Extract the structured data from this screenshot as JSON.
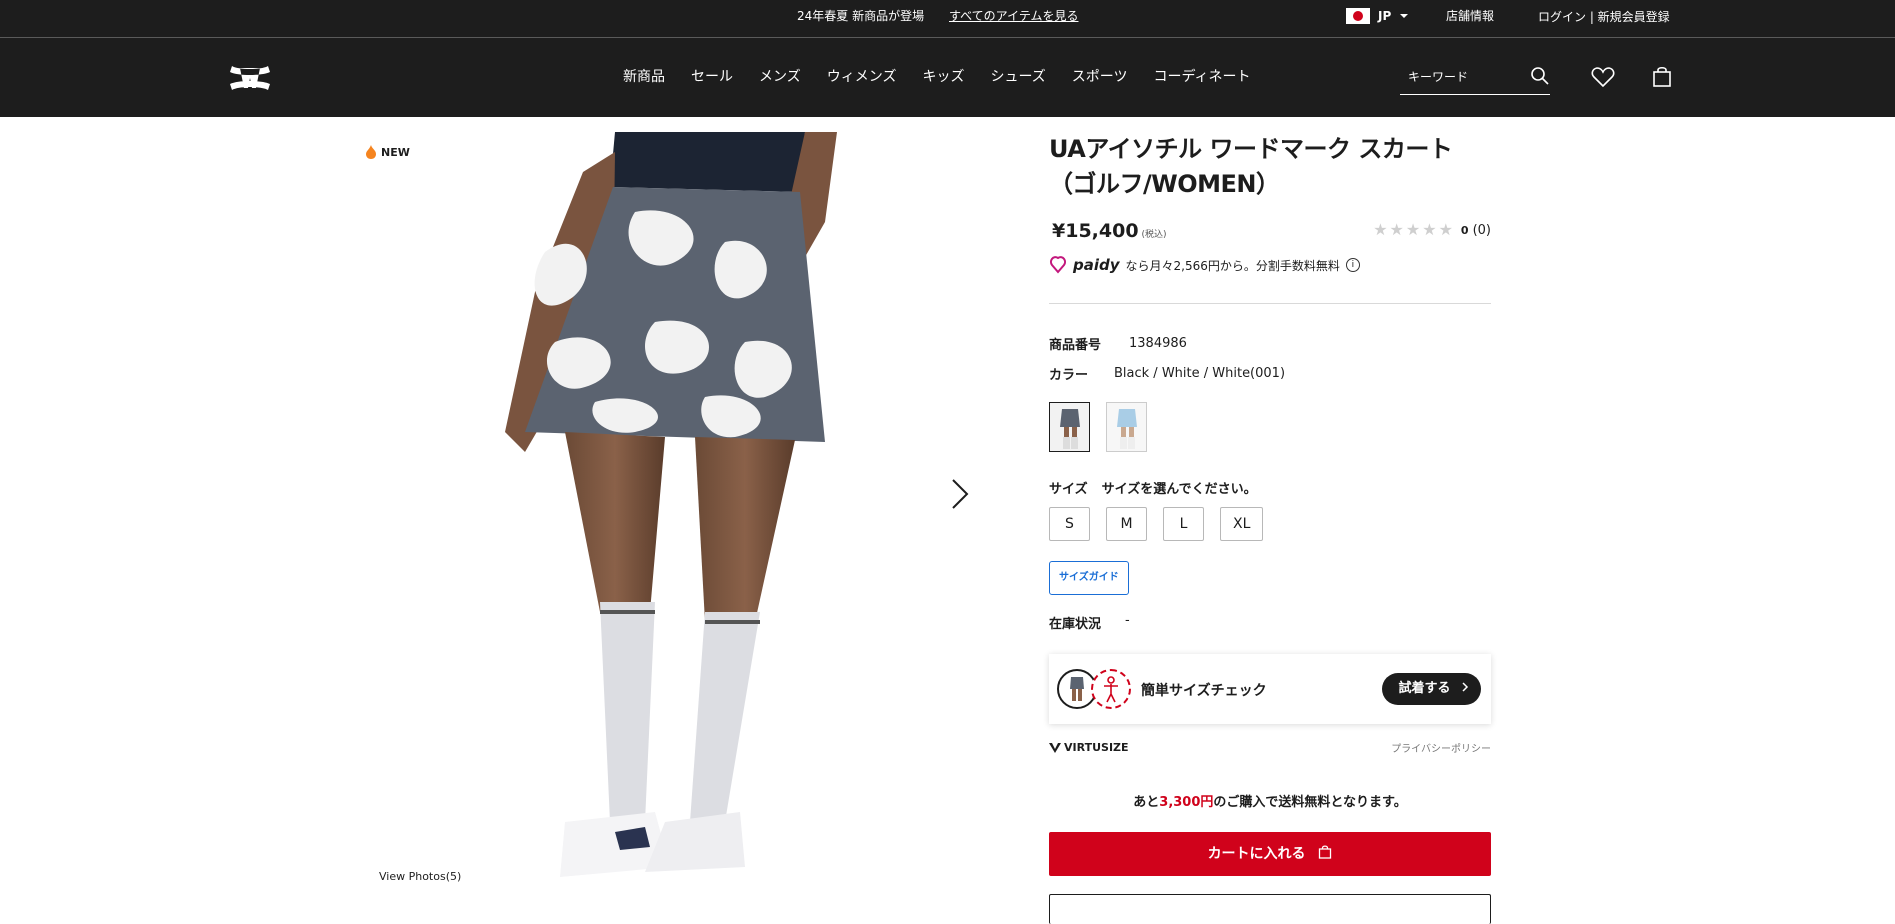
{
  "promo": {
    "message": "24年春夏 新商品が登場",
    "link": "すべてのアイテムを見る",
    "locale": "JP",
    "stores": "店舗情報",
    "login": "ログイン | 新規会員登録"
  },
  "header": {
    "nav": [
      "新商品",
      "セール",
      "メンズ",
      "ウィメンズ",
      "キッズ",
      "シューズ",
      "スポーツ",
      "コーディネート"
    ],
    "search_placeholder": "キーワード"
  },
  "gallery": {
    "badge": "NEW",
    "view_photos": "View Photos(5)"
  },
  "product": {
    "title_line1": "UAアイソチル ワードマーク スカート",
    "title_line2": "（ゴルフ/WOMEN）",
    "price": "¥15,400",
    "tax_note": "(税込)",
    "rating_value": "0",
    "rating_count": "(0)",
    "stars": 0,
    "paidy_logo": "paidy",
    "paidy_text": "なら月々2,566円から。分割手数料無料",
    "number_label": "商品番号",
    "number_value": "1384986",
    "color_label": "カラー",
    "color_value": "Black / White / White(001)",
    "size_label": "サイズ",
    "size_hint": "サイズを選んでください。",
    "sizes": [
      "S",
      "M",
      "L",
      "XL"
    ],
    "size_guide": "サイズガイド",
    "stock_label": "在庫状況",
    "stock_value": "-"
  },
  "virtusize": {
    "text": "簡単サイズチェック",
    "button": "試着する",
    "brand": "VIRTUSIZE",
    "policy": "プライバシーポリシー"
  },
  "shipping": {
    "prefix": "あと",
    "amount": "3,300円",
    "suffix": "のご購入で送料無料となります。"
  },
  "cart": {
    "add_label": "カートに入れる"
  },
  "colors": {
    "accent_red": "#d0021b",
    "header_bg": "#1d1d1d",
    "link_blue": "#1a6ed6"
  }
}
